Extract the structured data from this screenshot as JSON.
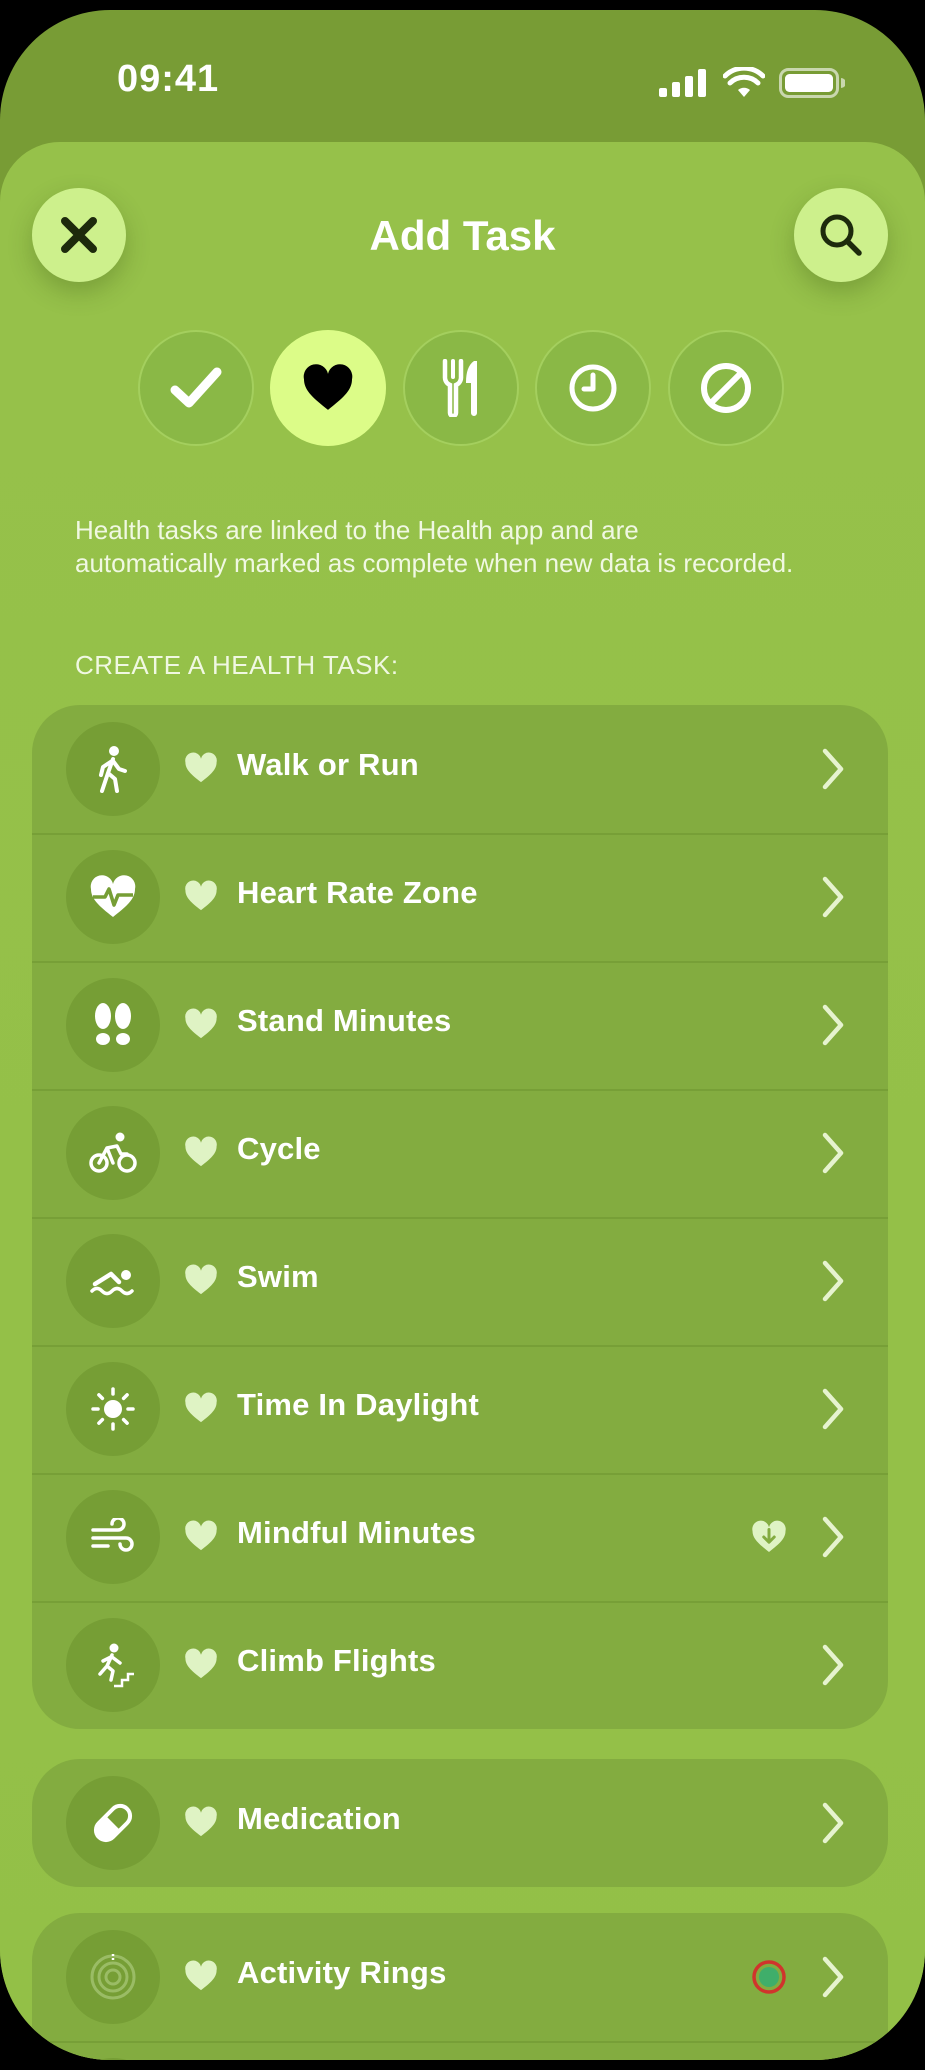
{
  "status_bar": {
    "time": "09:41",
    "icons": [
      "cellular-signal-icon",
      "wifi-icon",
      "battery-icon"
    ]
  },
  "header": {
    "title": "Add Task",
    "close_icon": "close-icon",
    "search_icon": "search-icon"
  },
  "categories": [
    {
      "icon": "checkmark-icon",
      "selected": false
    },
    {
      "icon": "heart-icon",
      "selected": true
    },
    {
      "icon": "fork-knife-icon",
      "selected": false
    },
    {
      "icon": "clock-icon",
      "selected": false
    },
    {
      "icon": "prohibited-icon",
      "selected": false
    }
  ],
  "description": "Health tasks are linked to the Health app and are automatically marked as complete when new data is recorded.",
  "section_header": "CREATE A HEALTH TASK:",
  "health_tasks": [
    {
      "label": "Walk or Run",
      "icon": "walking-figure-icon"
    },
    {
      "label": "Heart Rate Zone",
      "icon": "heart-rate-icon"
    },
    {
      "label": "Stand Minutes",
      "icon": "footprints-icon"
    },
    {
      "label": "Cycle",
      "icon": "cyclist-icon"
    },
    {
      "label": "Swim",
      "icon": "swimmer-icon"
    },
    {
      "label": "Time In Daylight",
      "icon": "sun-icon"
    },
    {
      "label": "Mindful Minutes",
      "icon": "wind-icon",
      "badge": "heart-download-icon"
    },
    {
      "label": "Climb Flights",
      "icon": "stairs-climber-icon"
    }
  ],
  "medication": {
    "label": "Medication",
    "icon": "pill-icon"
  },
  "activity": {
    "label": "Activity Rings",
    "icon": "activity-rings-icon",
    "badge": "ring-indicator-icon"
  },
  "colors": {
    "background": "#789c35",
    "sheet": "#96c14a",
    "list_group": "#83ac40",
    "accent": "#dcfc88",
    "button": "#cdf08c",
    "text": "#ffffff",
    "heart_row": "#dff3c4"
  }
}
